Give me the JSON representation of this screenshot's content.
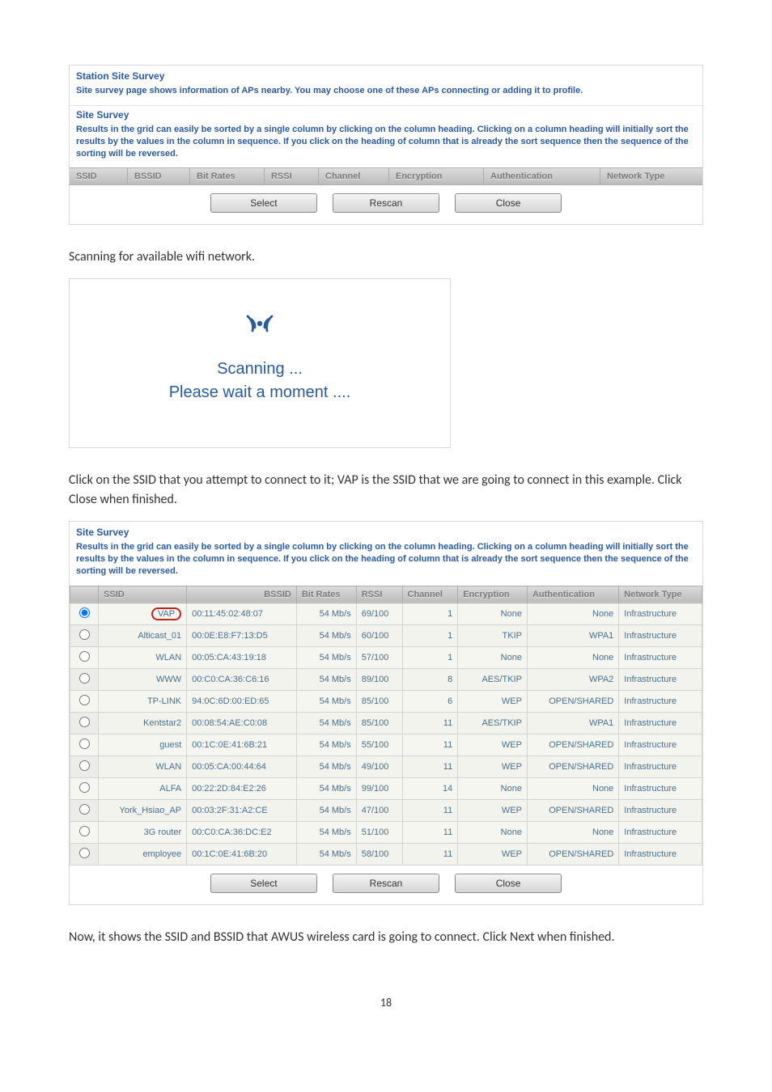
{
  "panel1": {
    "heading": "Station Site Survey",
    "desc": "Site survey page shows information of APs nearby. You may choose one of these APs connecting or adding it to profile.",
    "section_title": "Site Survey",
    "grid_desc": "Results in the grid can easily be sorted by a single column by clicking on the column heading. Clicking on a column heading will initially sort the results by the values in the column in sequence. If you click on the heading of column that is already the sort sequence then the sequence of the sorting will be reversed.",
    "cols": {
      "ssid": "SSID",
      "bssid": "BSSID",
      "bitrates": "Bit Rates",
      "rssi": "RSSI",
      "channel": "Channel",
      "encryption": "Encryption",
      "auth": "Authentication",
      "ntype": "Network Type"
    },
    "btn_select": "Select",
    "btn_rescan": "Rescan",
    "btn_close": "Close"
  },
  "text1": "Scanning for available wifi network.",
  "scan": {
    "scanning": "Scanning ...",
    "wait": "Please wait a moment ...."
  },
  "text2": "Click on the SSID that you attempt to connect to it; VAP is the SSID that we are going to connect in this example. Click Close when finished.",
  "survey2": {
    "title": "Site Survey",
    "desc": "Results in the grid can easily be sorted by a single column by clicking on the column heading. Clicking on a column heading will initially sort the results by the values in the column in sequence. If you click on the heading of column that is already the sort sequence then the sequence of the sorting will be reversed.",
    "cols": {
      "blank": "",
      "ssid": "SSID",
      "bssid": "BSSID",
      "bitrates": "Bit Rates",
      "rssi": "RSSI",
      "channel": "Channel",
      "encryption": "Encryption",
      "auth": "Authentication",
      "ntype": "Network Type"
    },
    "rows": [
      {
        "ssid": "VAP",
        "bssid": "00:11:45:02:48:07",
        "rate": "54 Mb/s",
        "rssi": "69/100",
        "ch": "1",
        "enc": "None",
        "auth": "None",
        "type": "Infrastructure",
        "sel": true
      },
      {
        "ssid": "Alticast_01",
        "bssid": "00:0E:E8:F7:13:D5",
        "rate": "54 Mb/s",
        "rssi": "60/100",
        "ch": "1",
        "enc": "TKIP",
        "auth": "WPA1",
        "type": "Infrastructure"
      },
      {
        "ssid": "WLAN",
        "bssid": "00:05:CA:43:19:18",
        "rate": "54 Mb/s",
        "rssi": "57/100",
        "ch": "1",
        "enc": "None",
        "auth": "None",
        "type": "Infrastructure"
      },
      {
        "ssid": "WWW",
        "bssid": "00:C0:CA:36:C6:16",
        "rate": "54 Mb/s",
        "rssi": "89/100",
        "ch": "8",
        "enc": "AES/TKIP",
        "auth": "WPA2",
        "type": "Infrastructure"
      },
      {
        "ssid": "TP-LINK",
        "bssid": "94:0C:6D:00:ED:65",
        "rate": "54 Mb/s",
        "rssi": "85/100",
        "ch": "6",
        "enc": "WEP",
        "auth": "OPEN/SHARED",
        "type": "Infrastructure"
      },
      {
        "ssid": "Kentstar2",
        "bssid": "00:08:54:AE:C0:08",
        "rate": "54 Mb/s",
        "rssi": "85/100",
        "ch": "11",
        "enc": "AES/TKIP",
        "auth": "WPA1",
        "type": "Infrastructure"
      },
      {
        "ssid": "guest",
        "bssid": "00:1C:0E:41:6B:21",
        "rate": "54 Mb/s",
        "rssi": "55/100",
        "ch": "11",
        "enc": "WEP",
        "auth": "OPEN/SHARED",
        "type": "Infrastructure"
      },
      {
        "ssid": "WLAN",
        "bssid": "00:05:CA:00:44:64",
        "rate": "54 Mb/s",
        "rssi": "49/100",
        "ch": "11",
        "enc": "WEP",
        "auth": "OPEN/SHARED",
        "type": "Infrastructure"
      },
      {
        "ssid": "ALFA",
        "bssid": "00:22:2D:84:E2:26",
        "rate": "54 Mb/s",
        "rssi": "99/100",
        "ch": "14",
        "enc": "None",
        "auth": "None",
        "type": "Infrastructure"
      },
      {
        "ssid": "York_Hsiao_AP",
        "bssid": "00:03:2F:31:A2:CE",
        "rate": "54 Mb/s",
        "rssi": "47/100",
        "ch": "11",
        "enc": "WEP",
        "auth": "OPEN/SHARED",
        "type": "Infrastructure"
      },
      {
        "ssid": "3G router",
        "bssid": "00:C0:CA:36:DC:E2",
        "rate": "54 Mb/s",
        "rssi": "51/100",
        "ch": "11",
        "enc": "None",
        "auth": "None",
        "type": "Infrastructure"
      },
      {
        "ssid": "employee",
        "bssid": "00:1C:0E:41:6B:20",
        "rate": "54 Mb/s",
        "rssi": "58/100",
        "ch": "11",
        "enc": "WEP",
        "auth": "OPEN/SHARED",
        "type": "Infrastructure"
      }
    ],
    "btn_select": "Select",
    "btn_rescan": "Rescan",
    "btn_close": "Close"
  },
  "text3": "Now, it shows the SSID and BSSID that AWUS wireless card is going to connect. Click Next when finished.",
  "pagenum": "18"
}
